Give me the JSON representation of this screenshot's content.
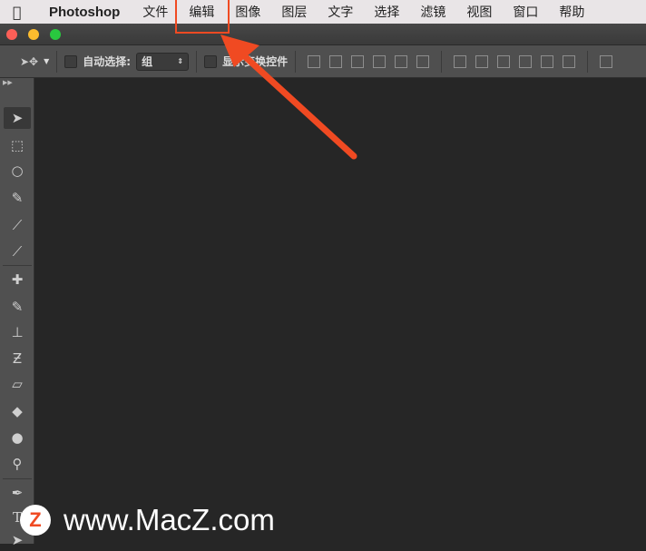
{
  "menubar": {
    "app": "Photoshop",
    "items": [
      "文件",
      "编辑",
      "图像",
      "图层",
      "文字",
      "选择",
      "滤镜",
      "视图",
      "窗口",
      "帮助"
    ],
    "highlighted": "编辑"
  },
  "options": {
    "auto_select_label": "自动选择:",
    "auto_select_value": "组",
    "show_transform_label": "显示变换控件"
  },
  "tools": [
    "move",
    "marquee",
    "lasso",
    "quick-selection",
    "crop",
    "eyedropper",
    "healing-brush",
    "brush",
    "clone-stamp",
    "history-brush",
    "eraser",
    "paint-bucket",
    "blur",
    "dodge",
    "pen",
    "type",
    "path-selection"
  ],
  "colors": {
    "annotation": "#f04a22",
    "canvas": "#262626"
  },
  "watermark": {
    "text": "www.MacZ.com",
    "logo": "Z"
  }
}
